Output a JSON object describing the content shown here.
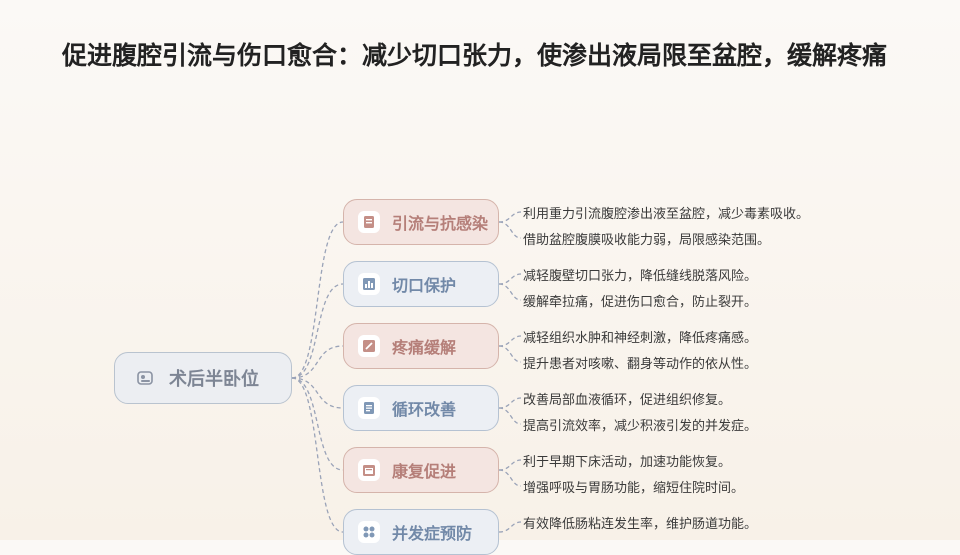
{
  "title": "促进腹腔引流与伤口愈合：减少切口张力，使渗出液局限至盆腔，缓解疼痛",
  "colors": {
    "warm_fill": "#f4e5e1",
    "warm_border": "#d5b4ab",
    "warm_text": "#b57f79",
    "cool_fill": "#eceff4",
    "cool_border": "#b5c2d2",
    "cool_text": "#7289a8",
    "root_fill": "#eceef2",
    "root_text": "#7d8594",
    "connector": "#9aa3b8"
  },
  "root": {
    "label": "术后半卧位",
    "icon": "patient-bed-icon"
  },
  "branches": [
    {
      "label": "引流与抗感染",
      "icon": "document-icon",
      "style": "warm",
      "details": [
        "利用重力引流腹腔渗出液至盆腔，减少毒素吸收。",
        "借助盆腔腹膜吸收能力弱，局限感染范围。"
      ]
    },
    {
      "label": "切口保护",
      "icon": "bar-chart-icon",
      "style": "cool",
      "details": [
        "减轻腹壁切口张力，降低缝线脱落风险。",
        "缓解牵拉痛，促进伤口愈合，防止裂开。"
      ]
    },
    {
      "label": "疼痛缓解",
      "icon": "edit-icon",
      "style": "warm",
      "details": [
        "减轻组织水肿和神经刺激，降低疼痛感。",
        "提升患者对咳嗽、翻身等动作的依从性。"
      ]
    },
    {
      "label": "循环改善",
      "icon": "notepad-icon",
      "style": "cool",
      "details": [
        "改善局部血液循环，促进组织修复。",
        "提高引流效率，减少积液引发的并发症。"
      ]
    },
    {
      "label": "康复促进",
      "icon": "calendar-icon",
      "style": "warm",
      "details": [
        "利于早期下床活动，加速功能恢复。",
        "增强呼吸与胃肠功能，缩短住院时间。"
      ]
    },
    {
      "label": "并发症预防",
      "icon": "grid-icon",
      "style": "cool",
      "details": [
        "有效降低肠粘连发生率，维护肠道功能。"
      ]
    }
  ]
}
